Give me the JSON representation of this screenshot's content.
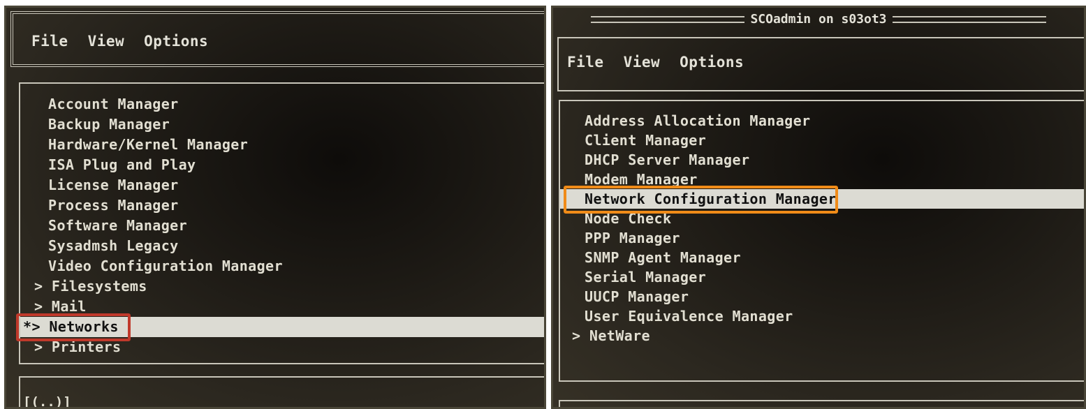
{
  "left": {
    "menu": [
      "File",
      "View",
      "Options"
    ],
    "items": [
      "Account Manager",
      "Backup Manager",
      "Hardware/Kernel Manager",
      "ISA Plug and Play",
      "License Manager",
      "Process Manager",
      "Software Manager",
      "Sysadmsh Legacy",
      "Video Configuration Manager",
      "> Filesystems",
      "> Mail",
      "*> Networks",
      "> Printers"
    ],
    "selected_index": 11,
    "status": "[(..)]"
  },
  "right": {
    "title": "SCOadmin on s03ot3",
    "menu": [
      "File",
      "View",
      "Options"
    ],
    "items": [
      "Address Allocation Manager",
      "Client Manager",
      "DHCP Server Manager",
      "Modem Manager",
      "Network Configuration Manager",
      "Node Check",
      "PPP Manager",
      "SNMP Agent Manager",
      "Serial Manager",
      "UUCP Manager",
      "User Equivalence Manager",
      "> NetWare"
    ],
    "selected_index": 4
  },
  "colors": {
    "highlight_left": "#c0392b",
    "highlight_right": "#f08b18"
  }
}
